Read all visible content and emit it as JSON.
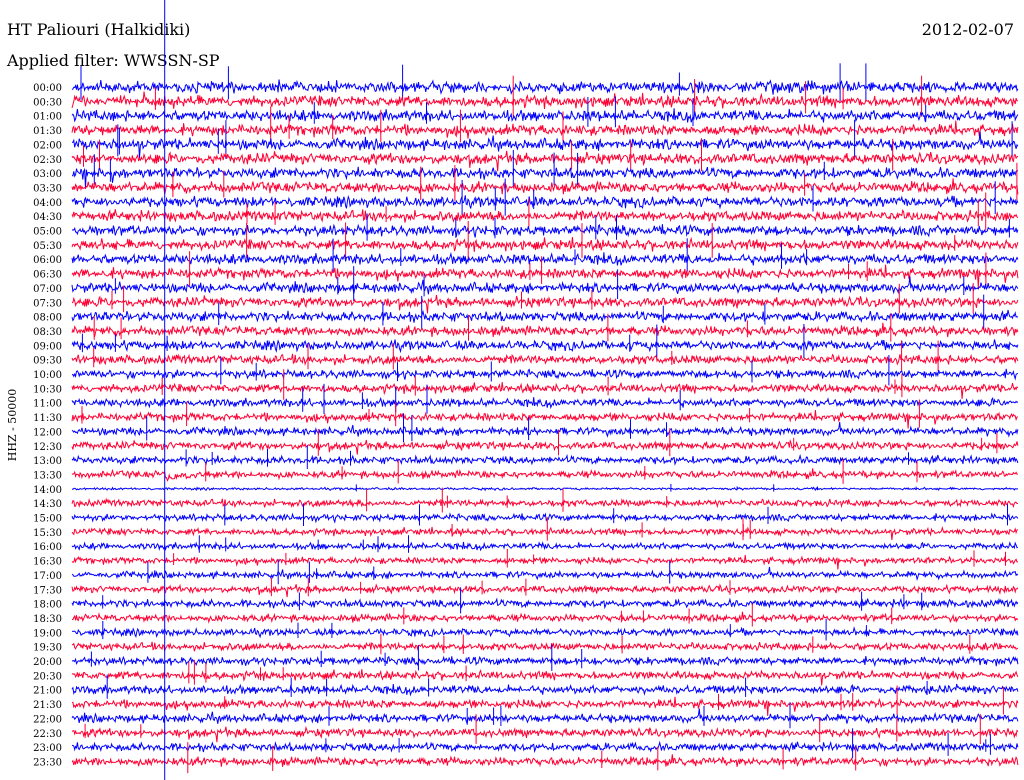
{
  "header": {
    "station": "HT Paliouri (Halkidiki)",
    "date": "2012-02-07",
    "filter": "Applied filter: WWSSN-SP"
  },
  "chart_data": {
    "type": "line",
    "title": "HT Paliouri (Halkidiki)",
    "subtitle": "Applied filter: WWSSN-SP",
    "ylabel": "HHZ - 50000",
    "xlabel": "",
    "date": "2012-02-07",
    "row_labels": [
      "00:00",
      "00:30",
      "01:00",
      "01:30",
      "02:00",
      "02:30",
      "03:00",
      "03:30",
      "04:00",
      "04:30",
      "05:00",
      "05:30",
      "06:00",
      "06:30",
      "07:00",
      "07:30",
      "08:00",
      "08:30",
      "09:00",
      "09:30",
      "10:00",
      "10:30",
      "11:00",
      "11:30",
      "12:00",
      "12:30",
      "13:00",
      "13:30",
      "14:00",
      "14:30",
      "15:00",
      "15:30",
      "16:00",
      "16:30",
      "17:00",
      "17:30",
      "18:00",
      "18:30",
      "19:00",
      "19:30",
      "20:00",
      "20:30",
      "21:00",
      "21:30",
      "22:00",
      "22:30",
      "23:00",
      "23:30"
    ],
    "row_amplitude": [
      1.0,
      0.97,
      0.95,
      0.95,
      0.95,
      0.95,
      0.92,
      0.92,
      0.9,
      0.9,
      0.9,
      0.9,
      0.88,
      0.88,
      0.85,
      0.85,
      0.85,
      0.82,
      0.8,
      0.78,
      0.72,
      0.72,
      0.7,
      0.7,
      0.68,
      0.68,
      0.66,
      0.62,
      0.2,
      0.6,
      0.58,
      0.56,
      0.55,
      0.55,
      0.58,
      0.6,
      0.65,
      0.62,
      0.6,
      0.65,
      0.68,
      0.7,
      0.72,
      0.72,
      0.72,
      0.72,
      0.7,
      0.72
    ],
    "series_colors": [
      "#0000ff",
      "#ff0033"
    ],
    "series": [
      {
        "name": "",
        "rows": "even",
        "color": "#0000ff"
      },
      {
        "name": "",
        "rows": "odd",
        "color": "#ff0033"
      }
    ],
    "events": [
      {
        "row": 27,
        "time_fraction": 0.098
      }
    ],
    "grid": false
  }
}
